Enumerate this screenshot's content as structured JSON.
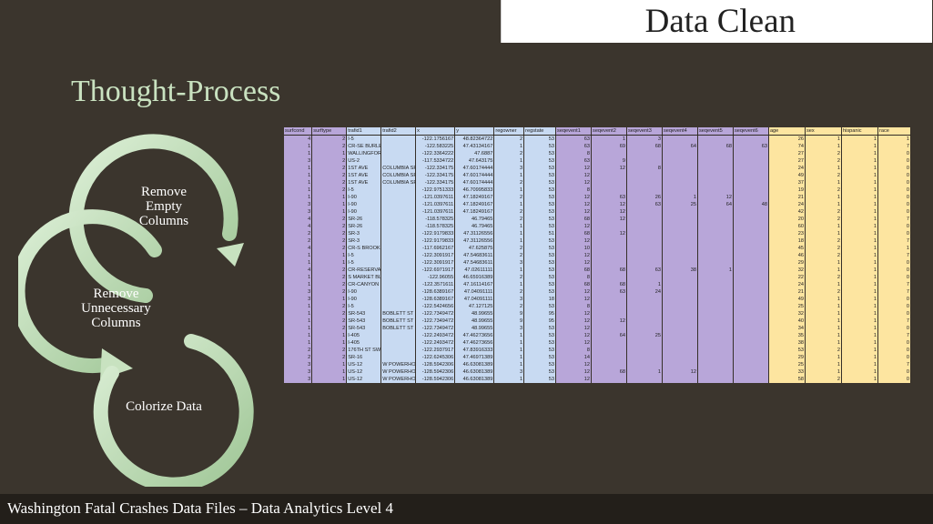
{
  "slide_title": "Data Clean",
  "heading": "Thought-Process",
  "steps": {
    "step1_line1": "Remove",
    "step1_line2": "Empty",
    "step1_line3": "Columns",
    "step2_line1": "Remove",
    "step2_line2": "Unnecessary",
    "step2_line3": "Columns",
    "step3_line1": "Colorize Data"
  },
  "footer": "Washington Fatal Crashes Data Files – Data Analytics Level 4",
  "colors": {
    "background": "#3b352d",
    "heading": "#c9e2c0",
    "purple": "#b8a6d9",
    "blue": "#c8daf2",
    "yellow": "#fde5a0",
    "arrow": "#b9d8b0"
  },
  "table": {
    "headers": [
      "surfcond",
      "surftype",
      "trafid1",
      "trafid2",
      "x",
      "y",
      "regowner",
      "regstate",
      "seqevent1",
      "seqevent2",
      "seqevent3",
      "seqevent4",
      "seqevent5",
      "seqevent6",
      "age",
      "sex",
      "hispanic",
      "race"
    ],
    "groups": [
      "g1",
      "g1",
      "g2",
      "g2",
      "g2",
      "g2",
      "g2",
      "g2",
      "g3",
      "g3",
      "g3",
      "g3",
      "g3",
      "g3",
      "g4",
      "g4",
      "g4",
      "g4"
    ],
    "rows": [
      [
        "4",
        "2",
        "I-5",
        "",
        "-122.1756167",
        "48.82364722",
        "2",
        "53",
        "63",
        "1",
        "3",
        "",
        "",
        "",
        "26",
        "1",
        "1",
        "1"
      ],
      [
        "1",
        "2",
        "CR-SE BURLEY OLALLA RD",
        "",
        "-122.583225",
        "47.43134167",
        "1",
        "53",
        "63",
        "69",
        "68",
        "64",
        "68",
        "63",
        "74",
        "1",
        "1",
        "7"
      ],
      [
        "1",
        "1",
        "WALLINGFORD N 82ND ST",
        "",
        "-122.3364222",
        "47.6887",
        "2",
        "53",
        "8",
        "",
        "",
        "",
        "",
        "",
        "27",
        "2",
        "1",
        "0"
      ],
      [
        "3",
        "2",
        "US-2",
        "",
        "-117.5334722",
        "47.643175",
        "1",
        "53",
        "63",
        "9",
        "",
        "",
        "",
        "",
        "27",
        "2",
        "1",
        "0"
      ],
      [
        "1",
        "2",
        "1ST AVE",
        "COLUMBIA SR",
        "-122.334175",
        "47.60174444",
        "3",
        "53",
        "12",
        "12",
        "8",
        "",
        "",
        "",
        "24",
        "1",
        "1",
        "0"
      ],
      [
        "1",
        "2",
        "1ST AVE",
        "COLUMBIA SR",
        "-122.334175",
        "47.60174444",
        "1",
        "53",
        "12",
        "",
        "",
        "",
        "",
        "",
        "49",
        "2",
        "1",
        "0"
      ],
      [
        "1",
        "2",
        "1ST AVE",
        "COLUMBIA SR",
        "-122.334175",
        "47.60174444",
        "2",
        "53",
        "12",
        "",
        "",
        "",
        "",
        "",
        "37",
        "1",
        "1",
        "0"
      ],
      [
        "1",
        "2",
        "I-5",
        "",
        "-122.9751333",
        "46.70995833",
        "1",
        "53",
        "8",
        "",
        "",
        "",
        "",
        "",
        "19",
        "2",
        "1",
        "0"
      ],
      [
        "1",
        "1",
        "I-90",
        "",
        "-121.0397611",
        "47.18249167",
        "2",
        "53",
        "12",
        "63",
        "26",
        "1",
        "12",
        "",
        "21",
        "1",
        "1",
        "0"
      ],
      [
        "3",
        "1",
        "I-90",
        "",
        "-121.0397611",
        "47.18249167",
        "1",
        "53",
        "12",
        "12",
        "63",
        "25",
        "64",
        "48",
        "24",
        "1",
        "1",
        "0"
      ],
      [
        "3",
        "1",
        "I-90",
        "",
        "-121.0397611",
        "47.18249167",
        "2",
        "53",
        "12",
        "12",
        "",
        "",
        "",
        "",
        "42",
        "2",
        "1",
        "0"
      ],
      [
        "4",
        "2",
        "SR-26",
        "",
        "-118.578325",
        "46.79465",
        "2",
        "53",
        "68",
        "12",
        "",
        "",
        "",
        "",
        "20",
        "2",
        "1",
        "7"
      ],
      [
        "4",
        "2",
        "SR-26",
        "",
        "-118.578325",
        "46.79465",
        "1",
        "53",
        "12",
        "",
        "",
        "",
        "",
        "",
        "60",
        "1",
        "1",
        "0"
      ],
      [
        "2",
        "2",
        "SR-3",
        "",
        "-122.9179833",
        "47.31126556",
        "1",
        "51",
        "68",
        "12",
        "",
        "",
        "",
        "",
        "23",
        "1",
        "1",
        "0"
      ],
      [
        "2",
        "2",
        "SR-3",
        "",
        "-122.9179833",
        "47.31126556",
        "1",
        "53",
        "12",
        "",
        "",
        "",
        "",
        "",
        "18",
        "2",
        "1",
        "7"
      ],
      [
        "4",
        "2",
        "CR-S BROOKS RD",
        "",
        "-117.6962167",
        "47.625875",
        "2",
        "53",
        "10",
        "",
        "",
        "",
        "",
        "",
        "45",
        "2",
        "1",
        "1"
      ],
      [
        "1",
        "1",
        "I-5",
        "",
        "-122.3091917",
        "47.54683611",
        "2",
        "53",
        "12",
        "",
        "",
        "",
        "",
        "",
        "46",
        "2",
        "1",
        "7"
      ],
      [
        "1",
        "1",
        "I-5",
        "",
        "-122.3091917",
        "47.54683611",
        "3",
        "53",
        "12",
        "",
        "",
        "",
        "",
        "",
        "29",
        "1",
        "1",
        "0"
      ],
      [
        "4",
        "2",
        "CR-RESERVATION RD",
        "",
        "-122.6971917",
        "47.02611111",
        "1",
        "53",
        "68",
        "68",
        "63",
        "38",
        "1",
        "",
        "32",
        "1",
        "1",
        "0"
      ],
      [
        "1",
        "2",
        "S MARKET BLV 4TH ST",
        "",
        "-122.96055",
        "46.65916389",
        "2",
        "53",
        "8",
        "",
        "",
        "",
        "",
        "",
        "22",
        "2",
        "1",
        "0"
      ],
      [
        "1",
        "2",
        "CR-CANYON RI 104TH ST E",
        "",
        "-122.3571611",
        "47.16114167",
        "1",
        "53",
        "68",
        "68",
        "1",
        "",
        "",
        "",
        "24",
        "1",
        "1",
        "7"
      ],
      [
        "3",
        "2",
        "I-90",
        "",
        "-128.6389167",
        "47.04091111",
        "2",
        "53",
        "12",
        "63",
        "24",
        "",
        "",
        "",
        "21",
        "2",
        "1",
        "7"
      ],
      [
        "3",
        "1",
        "I-90",
        "",
        "-128.6389167",
        "47.04091111",
        "3",
        "18",
        "12",
        "",
        "",
        "",
        "",
        "",
        "49",
        "1",
        "1",
        "0"
      ],
      [
        "1",
        "2",
        "I-5",
        "",
        "-122.5424656",
        "47.127125",
        "2",
        "53",
        "8",
        "",
        "",
        "",
        "",
        "",
        "25",
        "1",
        "1",
        "0"
      ],
      [
        "1",
        "2",
        "SR-543",
        "BOBLETT ST",
        "-122.7349472",
        "48.99655",
        "9",
        "95",
        "12",
        "",
        "",
        "",
        "",
        "",
        "32",
        "1",
        "1",
        "0"
      ],
      [
        "1",
        "2",
        "SR-543",
        "BOBLETT ST",
        "-122.7349472",
        "48.99655",
        "9",
        "95",
        "12",
        "12",
        "",
        "",
        "",
        "",
        "40",
        "1",
        "1",
        "7"
      ],
      [
        "1",
        "2",
        "SR-543",
        "BOBLETT ST",
        "-122.7349472",
        "48.99655",
        "3",
        "53",
        "12",
        "",
        "",
        "",
        "",
        "",
        "34",
        "1",
        "1",
        "0"
      ],
      [
        "1",
        "1",
        "I-405",
        "",
        "-122.2493472",
        "47.46273656",
        "1",
        "53",
        "12",
        "64",
        "25",
        "",
        "",
        "",
        "35",
        "1",
        "1",
        "7"
      ],
      [
        "1",
        "1",
        "I-405",
        "",
        "-122.2493472",
        "47.46273656",
        "1",
        "53",
        "12",
        "",
        "",
        "",
        "",
        "",
        "38",
        "1",
        "1",
        "0"
      ],
      [
        "2",
        "2",
        "176TH ST SW",
        "",
        "-122.2937917",
        "47.83916333",
        "1",
        "53",
        "8",
        "",
        "",
        "",
        "",
        "",
        "53",
        "2",
        "1",
        "0"
      ],
      [
        "2",
        "2",
        "SR-16",
        "",
        "-122.6245306",
        "47.46971389",
        "1",
        "53",
        "14",
        "",
        "",
        "",
        "",
        "",
        "29",
        "1",
        "1",
        "0"
      ],
      [
        "3",
        "1",
        "US-12",
        "W POWERHOU",
        "-128.5942306",
        "46.63081389",
        "1",
        "53",
        "12",
        "",
        "",
        "",
        "",
        "",
        "25",
        "1",
        "1",
        "7"
      ],
      [
        "3",
        "1",
        "US-12",
        "W POWERHOU",
        "-128.5942306",
        "46.63081389",
        "3",
        "53",
        "12",
        "68",
        "1",
        "12",
        "",
        "",
        "33",
        "1",
        "1",
        "0"
      ],
      [
        "3",
        "1",
        "US-12",
        "W POWERHOU",
        "-128.5942306",
        "46.63081389",
        "1",
        "53",
        "12",
        "",
        "",
        "",
        "",
        "",
        "58",
        "2",
        "1",
        "0"
      ]
    ]
  }
}
